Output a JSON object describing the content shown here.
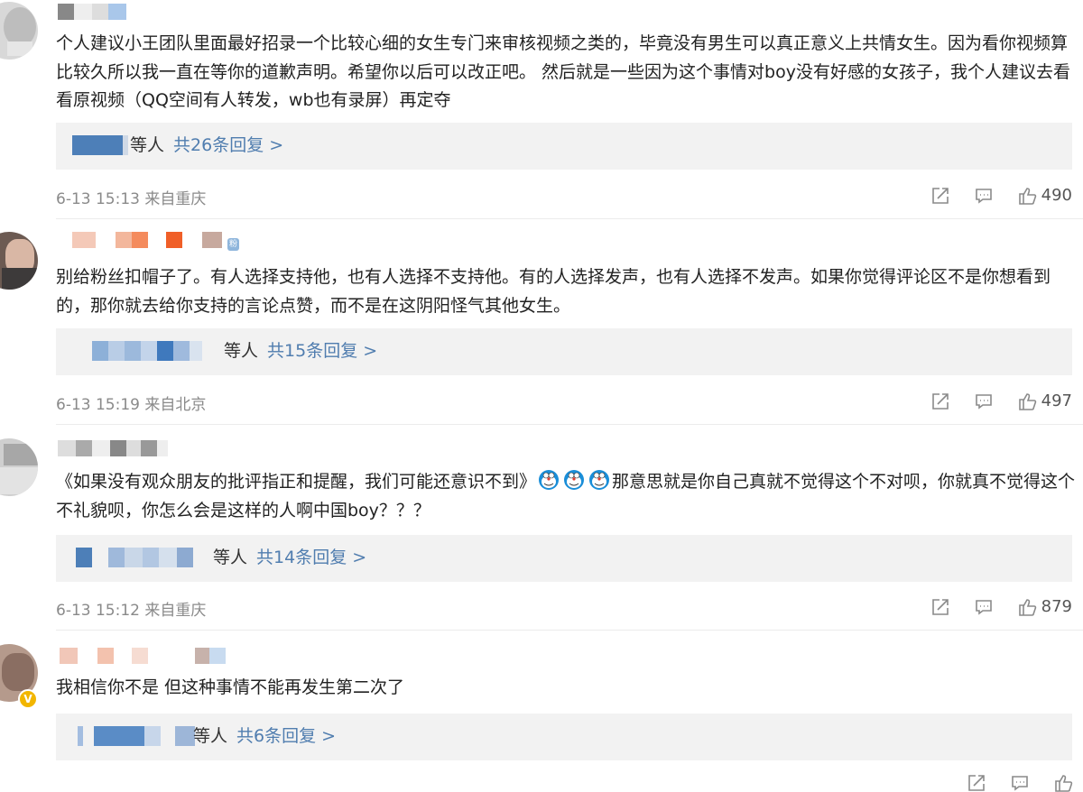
{
  "comments": [
    {
      "text": "个人建议小王团队里面最好招录一个比较心细的女生专门来审核视频之类的，毕竟没有男生可以真正意义上共情女生。因为看你视频算比较久所以我一直在等你的道歉声明。希望你以后可以改正吧。 然后就是一些因为这个事情对boy没有好感的女孩子，我个人建议去看看原视频（QQ空间有人转发，wb也有录屏）再定夺",
      "reply_suffix": "等人",
      "reply_link": "共26条回复 >",
      "time": "6-13 15:13",
      "location": "来自重庆",
      "likes": "490"
    },
    {
      "badge": "粉",
      "text": "别给粉丝扣帽子了。有人选择支持他，也有人选择不支持他。有的人选择发声，也有人选择不发声。如果你觉得评论区不是你想看到的，那你就去给你支持的言论点赞，而不是在这阴阳怪气其他女生。",
      "reply_suffix": "等人",
      "reply_link": "共15条回复 >",
      "time": "6-13 15:19",
      "location": "来自北京",
      "likes": "497"
    },
    {
      "text_part1": "《如果没有观众朋友的批评指正和提醒，我们可能还意识不到》",
      "text_part2": "那意思就是你自己真就不觉得这个不对呗，你就真不觉得这个不礼貌呗，你怎么会是这样的人啊中国boy？？？",
      "reply_suffix": "等人",
      "reply_link": "共14条回复 >",
      "time": "6-13 15:12",
      "location": "来自重庆",
      "likes": "879"
    },
    {
      "verified": "V",
      "text": "我相信你不是 但这种事情不能再发生第二次了",
      "reply_suffix": "等人",
      "reply_link": "共6条回复 >"
    }
  ],
  "icons": {
    "share": "share-icon",
    "comment": "comment-icon",
    "like": "thumbs-up-icon",
    "emoji": "doraemon-emoji-icon"
  },
  "colors": {
    "link": "#507daf",
    "meta": "#8a8a8a",
    "reply_bg": "#f2f2f2"
  }
}
